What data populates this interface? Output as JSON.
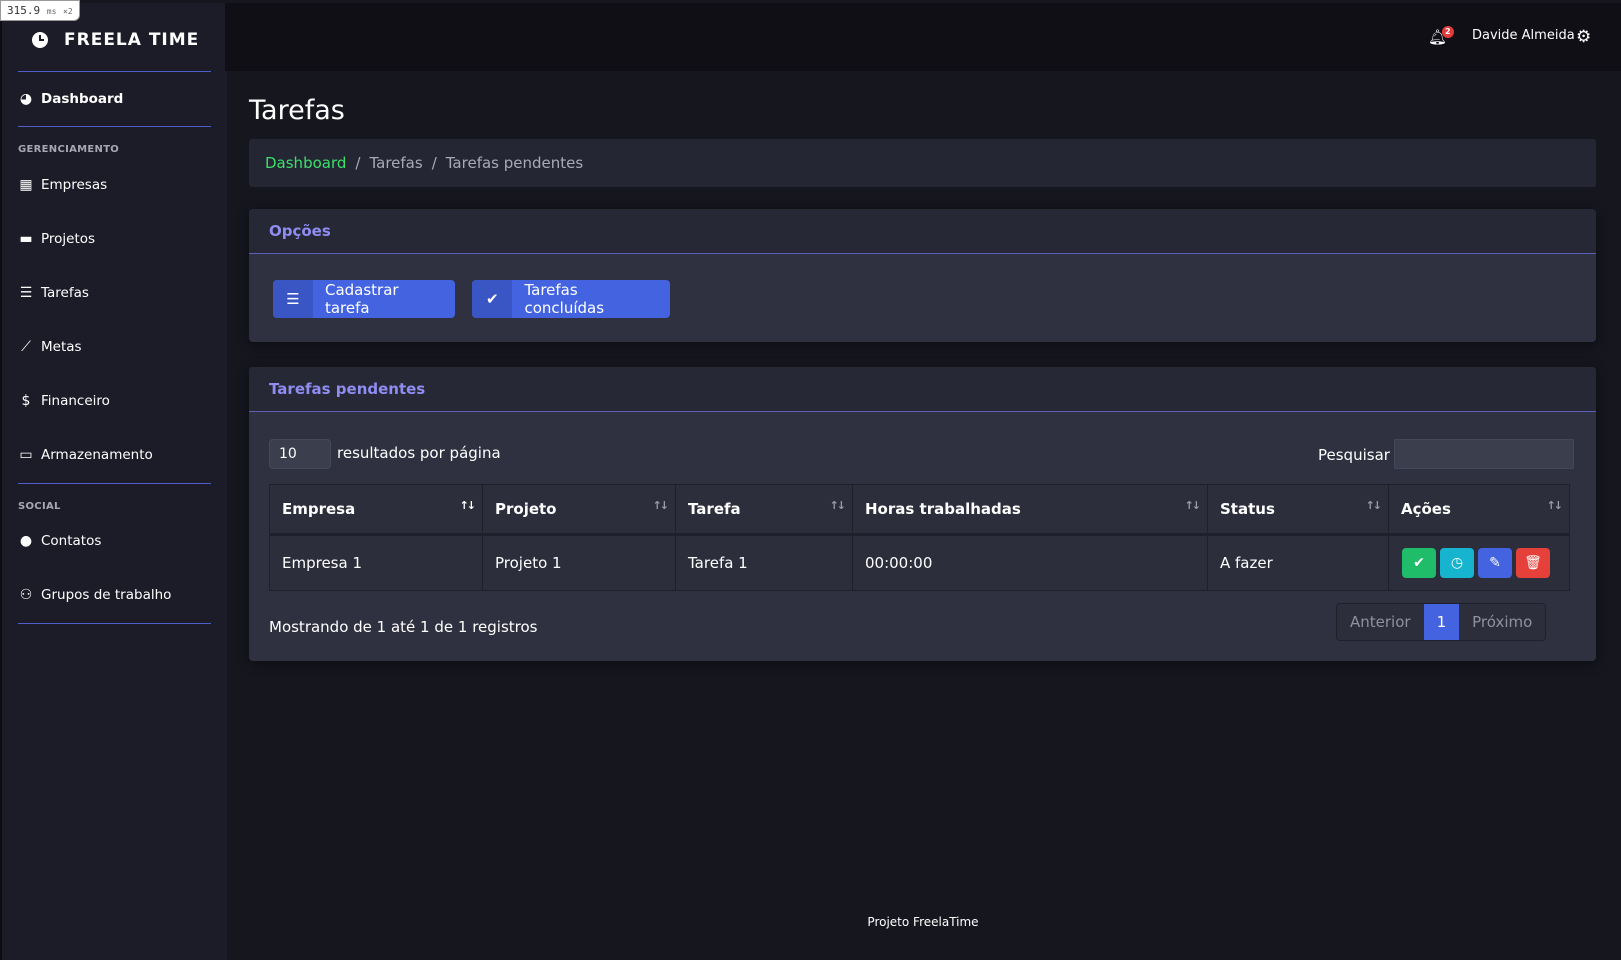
{
  "perf": {
    "value": "315.9",
    "unit": "ms",
    "mult": "×2"
  },
  "brand": {
    "title": "FREELA TIME",
    "icon": "clock-icon"
  },
  "sidebar": {
    "dashboard": "Dashboard",
    "section_management": "GERENCIAMENTO",
    "items": [
      "Empresas",
      "Projetos",
      "Tarefas",
      "Metas",
      "Financeiro",
      "Armazenamento"
    ],
    "section_social": "SOCIAL",
    "social_items": [
      "Contatos",
      "Grupos de trabalho"
    ]
  },
  "topbar": {
    "notifications": "2",
    "username": "Davide Almeida"
  },
  "page": {
    "title": "Tarefas"
  },
  "breadcrumb": {
    "home": "Dashboard",
    "level1": "Tarefas",
    "current": "Tarefas pendentes"
  },
  "options": {
    "title": "Opções",
    "btn_new": "Cadastrar tarefa",
    "btn_done": "Tarefas concluídas"
  },
  "pending": {
    "title": "Tarefas pendentes",
    "page_length": "10",
    "page_length_label": "resultados por página",
    "search_label": "Pesquisar",
    "columns": [
      "Empresa",
      "Projeto",
      "Tarefa",
      "Horas trabalhadas",
      "Status",
      "Ações"
    ],
    "rows": [
      {
        "empresa": "Empresa 1",
        "projeto": "Projeto 1",
        "tarefa": "Tarefa 1",
        "horas": "00:00:00",
        "status": "A fazer"
      }
    ],
    "info": "Mostrando de 1 até 1 de 1 registros",
    "prev": "Anterior",
    "page": "1",
    "next": "Próximo"
  },
  "colors": {
    "complete": "#1fbd6a",
    "time": "#17b4d0",
    "edit": "#4463e0",
    "delete": "#e5403a",
    "accent": "#8f8cf2",
    "link": "#3be06a"
  },
  "footer": "Projeto FreelaTime"
}
